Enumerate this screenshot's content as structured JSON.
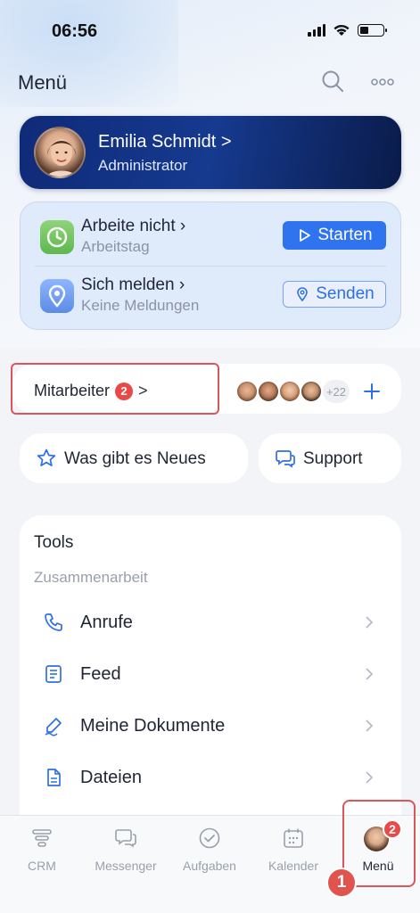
{
  "status_bar": {
    "time": "06:56"
  },
  "header": {
    "title": "Menü"
  },
  "profile": {
    "name": "Emilia Schmidt",
    "chevron": ">",
    "role": "Administrator"
  },
  "work": {
    "status_title": "Arbeite nicht",
    "status_sub": "Arbeitstag",
    "start_label": "Starten",
    "report_title": "Sich melden",
    "report_sub": "Keine Meldungen",
    "send_label": "Senden"
  },
  "employees": {
    "label": "Mitarbeiter",
    "badge": "2",
    "chevron": ">",
    "more_count": "+22"
  },
  "quick": {
    "news_label": "Was gibt es Neues",
    "support_label": "Support"
  },
  "tools": {
    "title": "Tools",
    "section": "Zusammenarbeit",
    "items": [
      {
        "label": "Anrufe",
        "icon": "phone-icon"
      },
      {
        "label": "Feed",
        "icon": "feed-icon"
      },
      {
        "label": "Meine Dokumente",
        "icon": "signature-icon"
      },
      {
        "label": "Dateien",
        "icon": "file-icon"
      }
    ]
  },
  "tabs": [
    {
      "label": "CRM",
      "icon": "crm-icon"
    },
    {
      "label": "Messenger",
      "icon": "messenger-icon"
    },
    {
      "label": "Aufgaben",
      "icon": "tasks-icon"
    },
    {
      "label": "Kalender",
      "icon": "calendar-icon"
    },
    {
      "label": "Menü",
      "icon": "avatar",
      "badge": "2",
      "active": true
    }
  ],
  "annotation": {
    "step": "1"
  },
  "colors": {
    "accent": "#2f74ee",
    "badge": "#e84a4a",
    "highlight": "#d9575a",
    "profile_card": "#163a8f"
  }
}
